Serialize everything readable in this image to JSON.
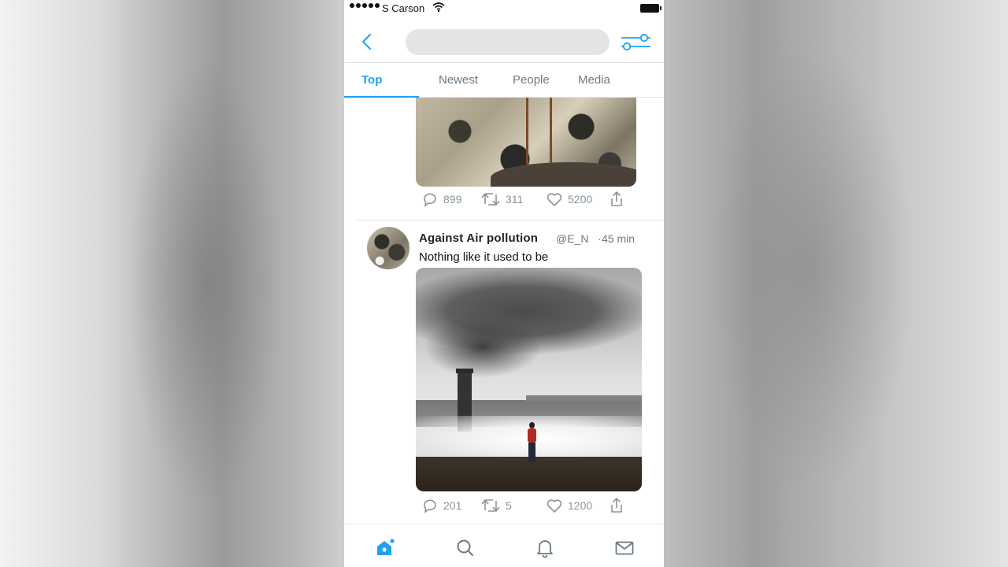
{
  "status_bar": {
    "carrier": "S Carson"
  },
  "search": {
    "placeholder": ""
  },
  "tabs": [
    {
      "label": "Top",
      "active": true
    },
    {
      "label": "Newest",
      "active": false
    },
    {
      "label": "People",
      "active": false
    },
    {
      "label": "Media",
      "active": false
    }
  ],
  "feed": {
    "tweets": [
      {
        "replies": "899",
        "retweets": "311",
        "likes": "5200"
      },
      {
        "name": "Against Air pollution",
        "handle": "@E_N",
        "dot": "·",
        "time": "45 min",
        "text": "Nothing like it used to be",
        "replies": "201",
        "retweets": "5",
        "likes": "1200"
      }
    ]
  },
  "bottom_nav": {
    "items": [
      {
        "icon": "home-icon",
        "active": true,
        "has_notification": true
      },
      {
        "icon": "search-icon",
        "active": false
      },
      {
        "icon": "bell-icon",
        "active": false
      },
      {
        "icon": "mail-icon",
        "active": false
      }
    ]
  },
  "colors": {
    "accent": "#1da1f2",
    "muted": "#6a7a85",
    "icon_gray": "#8a949b"
  }
}
